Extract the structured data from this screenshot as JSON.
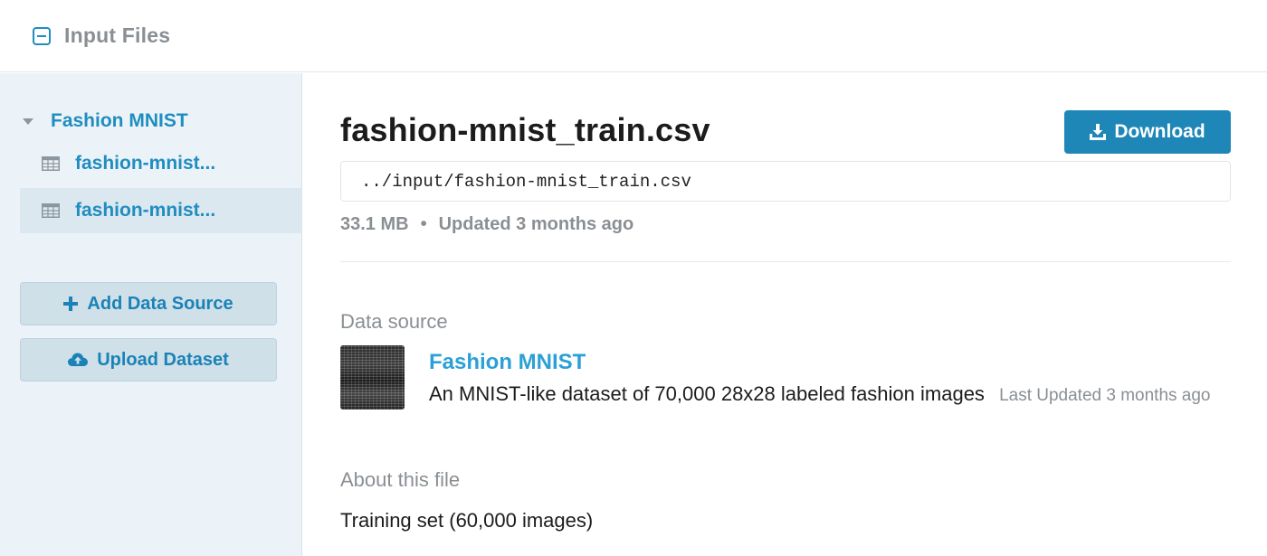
{
  "header": {
    "title": "Input Files"
  },
  "sidebar": {
    "dataset_name": "Fashion MNIST",
    "files": [
      {
        "label": "fashion-mnist..."
      },
      {
        "label": "fashion-mnist..."
      }
    ],
    "add_source_label": "Add Data Source",
    "upload_label": "Upload Dataset"
  },
  "file": {
    "name": "fashion-mnist_train.csv",
    "download_label": "Download",
    "path": "../input/fashion-mnist_train.csv",
    "size": "33.1 MB",
    "separator": "•",
    "updated": "Updated 3 months ago"
  },
  "data_source": {
    "heading": "Data source",
    "name": "Fashion MNIST",
    "description": "An MNIST-like dataset of 70,000 28x28 labeled fashion images",
    "last_updated": "Last Updated 3 months ago"
  },
  "about": {
    "heading": "About this file",
    "text": "Training set (60,000 images)"
  },
  "colors": {
    "accent": "#1f8dc0",
    "download_bg": "#1e87b8",
    "sidebar_bg": "#ecf3f8",
    "muted_text": "#8a8f94"
  }
}
